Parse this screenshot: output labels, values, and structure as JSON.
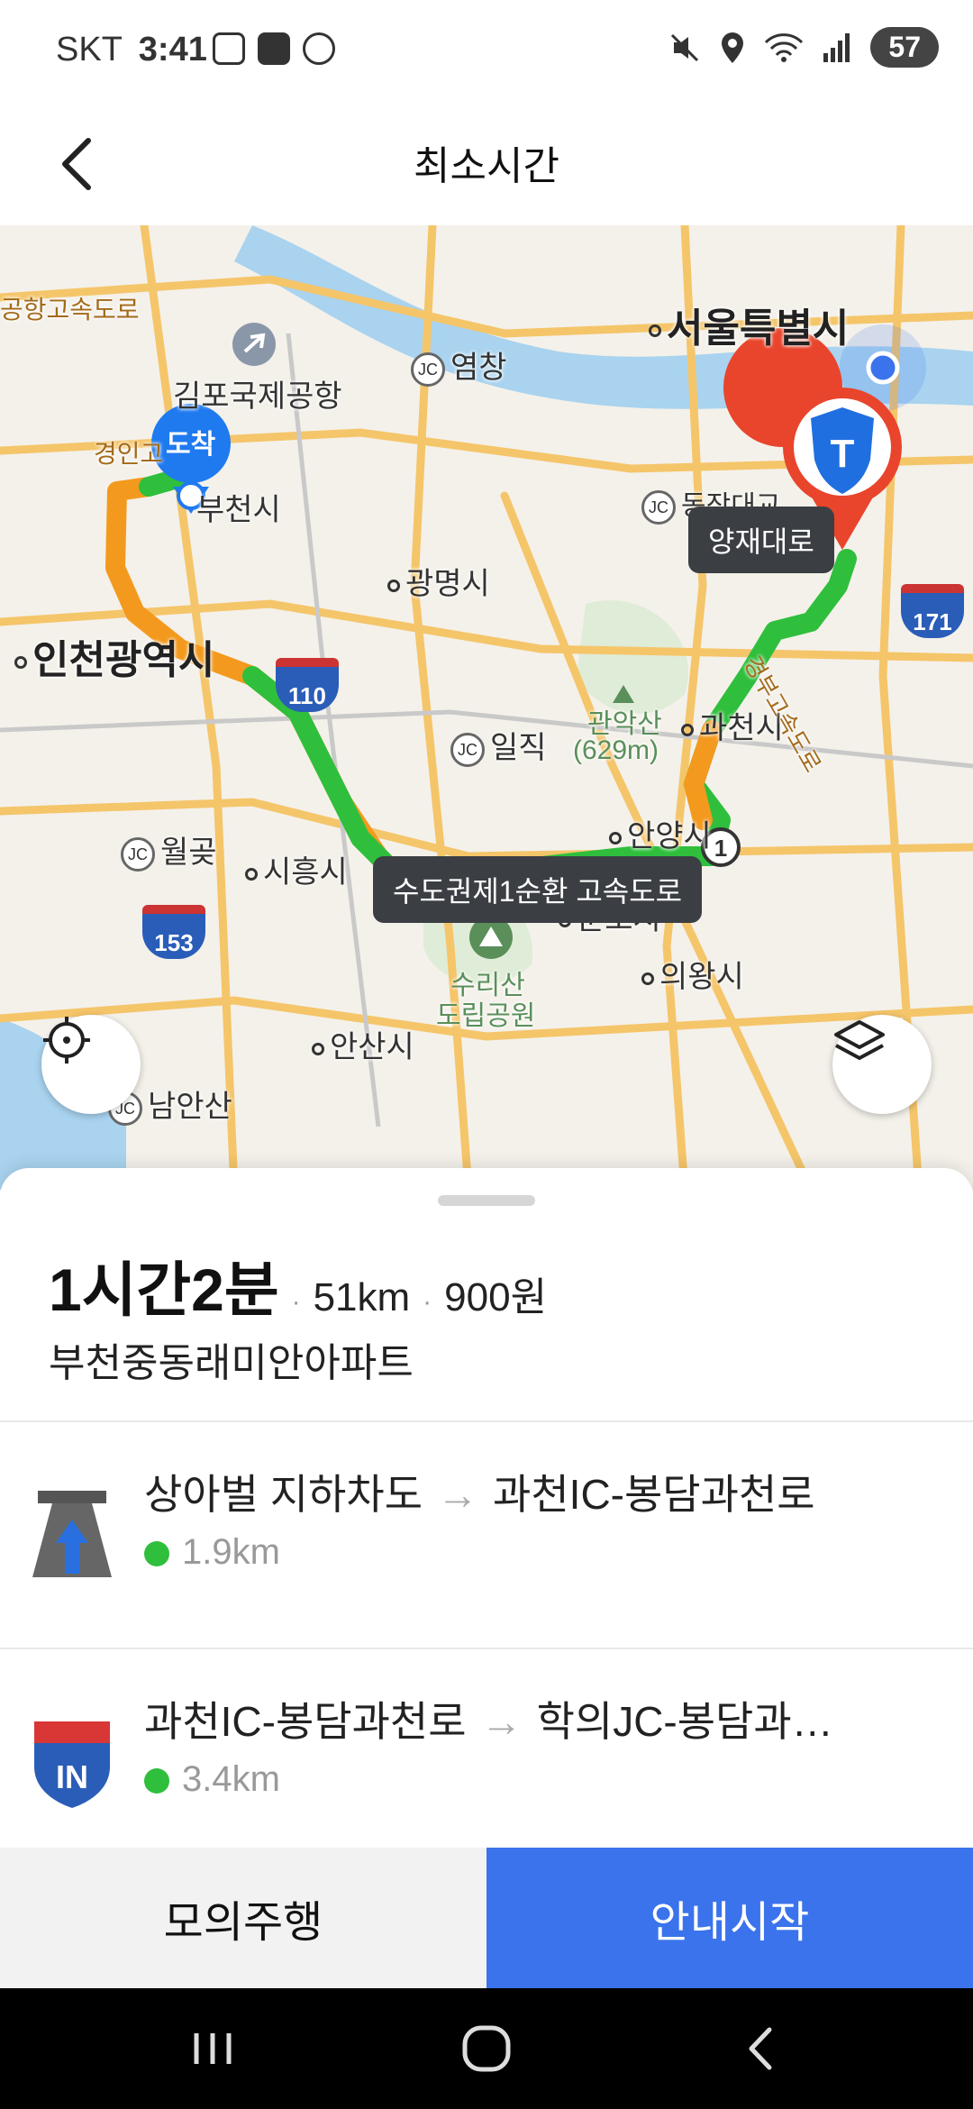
{
  "status_bar": {
    "carrier": "SKT",
    "time": "3:41",
    "battery": "57"
  },
  "header": {
    "title": "최소시간"
  },
  "map": {
    "labels": {
      "seoul": "서울특별시",
      "gimpo_airport": "김포국제공항",
      "yeomchang": "염창",
      "bucheon": "부천시",
      "gwangmyeong": "광명시",
      "incheon": "인천광역시",
      "gwanaksan": "관악산",
      "gwanaksan_height": "(629m)",
      "gwacheon": "과천시",
      "ilzik": "일직",
      "wolgot": "월곶",
      "siheung": "시흥시",
      "anyang": "안양시",
      "gunpo": "군포시",
      "uiwang": "의왕시",
      "surisan": "수리산",
      "surisan2": "도립공원",
      "ansan": "안산시",
      "namansan": "남안산",
      "airport_road": "공항고속도로",
      "gyeongin": "경인고",
      "dongjak": "동작대교",
      "gyeongbu": "경부고속도로"
    },
    "arrival_marker": "도착",
    "start_callout": "양재대로",
    "highway_callout": "수도권제1순환 고속도로",
    "shields": [
      "110",
      "153",
      "171"
    ],
    "jc_label": "JC"
  },
  "summary": {
    "duration": "1시간2분",
    "distance": "51km",
    "toll": "900원",
    "destination": "부천중동래미안아파트"
  },
  "steps": [
    {
      "from": "상아벌 지하차도",
      "arrow": "→",
      "to": "과천IC-봉담과천로",
      "distance": "1.9km",
      "icon": "underpass-icon"
    },
    {
      "from": "과천IC-봉담과천로",
      "arrow": "→",
      "to": "학의JC-봉담과…",
      "distance": "3.4km",
      "icon": "highway-in-icon"
    }
  ],
  "actions": {
    "simulate": "모의주행",
    "start": "안내시작"
  },
  "colors": {
    "accent": "#3b73ec",
    "route_green": "#2fbf3c",
    "route_orange": "#f39a1e"
  }
}
